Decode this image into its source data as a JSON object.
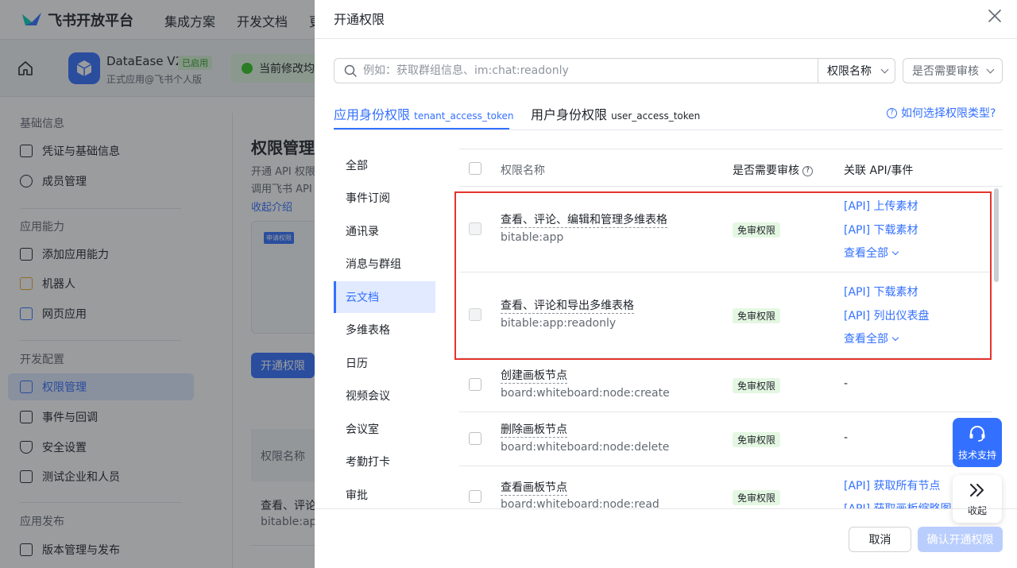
{
  "topnav": {
    "logo_text": "飞书开放平台",
    "items": [
      "集成方案",
      "开发文档",
      "更"
    ]
  },
  "appbar": {
    "app_name": "DataEase V2",
    "app_badge": "已启用",
    "app_sub": "正式应用@飞书个人版",
    "notice": "当前修改均"
  },
  "sidebar": {
    "groups": [
      "基础信息",
      "应用能力",
      "开发配置",
      "应用发布"
    ],
    "items": [
      {
        "label": "凭证与基础信息",
        "icon": "credential-icon"
      },
      {
        "label": "成员管理",
        "icon": "member-icon"
      },
      {
        "label": "添加应用能力",
        "icon": "grid-icon"
      },
      {
        "label": "机器人",
        "icon": "robot-icon"
      },
      {
        "label": "网页应用",
        "icon": "web-icon"
      },
      {
        "label": "权限管理",
        "icon": "permission-icon",
        "active": true
      },
      {
        "label": "事件与回调",
        "icon": "event-icon"
      },
      {
        "label": "安全设置",
        "icon": "shield-icon"
      },
      {
        "label": "测试企业和人员",
        "icon": "test-icon"
      },
      {
        "label": "版本管理与发布",
        "icon": "release-icon"
      }
    ]
  },
  "content": {
    "title": "权限管理",
    "desc1": "开通 API 权限",
    "desc2": "调用飞书 API",
    "collapse": "收起介绍",
    "illus_tag": "申请权限",
    "open_button": "开通权限",
    "table_head": "权限名称",
    "row_text1": "查看、评论",
    "row_text2": "bitable:app"
  },
  "drawer": {
    "title": "开通权限",
    "search_placeholder": "例如：获取群组信息、im:chat:readonly",
    "select_a": "权限名称",
    "select_b": "是否需要审核",
    "tabs": [
      {
        "label": "应用身份权限",
        "sub": "tenant_access_token"
      },
      {
        "label": "用户身份权限",
        "sub": "user_access_token"
      }
    ],
    "help_link": "如何选择权限类型?",
    "categories": [
      "全部",
      "事件订阅",
      "通讯录",
      "消息与群组",
      "云文档",
      "多维表格",
      "日历",
      "视频会议",
      "会议室",
      "考勤打卡",
      "审批"
    ],
    "active_category": "云文档",
    "columns": {
      "name": "权限名称",
      "review": "是否需要审核",
      "api": "关联 API/事件"
    },
    "rows": [
      {
        "name": "查看、评论、编辑和管理多维表格",
        "scope": "bitable:app",
        "badge": "免审权限",
        "apis": [
          "[API] 上传素材",
          "[API] 下载素材"
        ],
        "more": "查看全部"
      },
      {
        "name": "查看、评论和导出多维表格",
        "scope": "bitable:app:readonly",
        "badge": "免审权限",
        "apis": [
          "[API] 下载素材",
          "[API] 列出仪表盘"
        ],
        "more": "查看全部"
      },
      {
        "name": "创建画板节点",
        "scope": "board:whiteboard:node:create",
        "badge": "免审权限",
        "dash": "-"
      },
      {
        "name": "删除画板节点",
        "scope": "board:whiteboard:node:delete",
        "badge": "免审权限",
        "dash": "-"
      },
      {
        "name": "查看画板节点",
        "scope": "board:whiteboard:node:read",
        "badge": "免审权限",
        "apis": [
          "[API] 获取所有节点",
          "[API] 获取画板缩略图"
        ]
      }
    ],
    "float_support": "技术支持",
    "float_collapse": "收起",
    "cancel": "取消",
    "confirm": "确认开通权限"
  },
  "colors": {
    "accent": "#3370ff",
    "highlight": "#e5332b",
    "badge_bg": "#e4f7e2"
  }
}
